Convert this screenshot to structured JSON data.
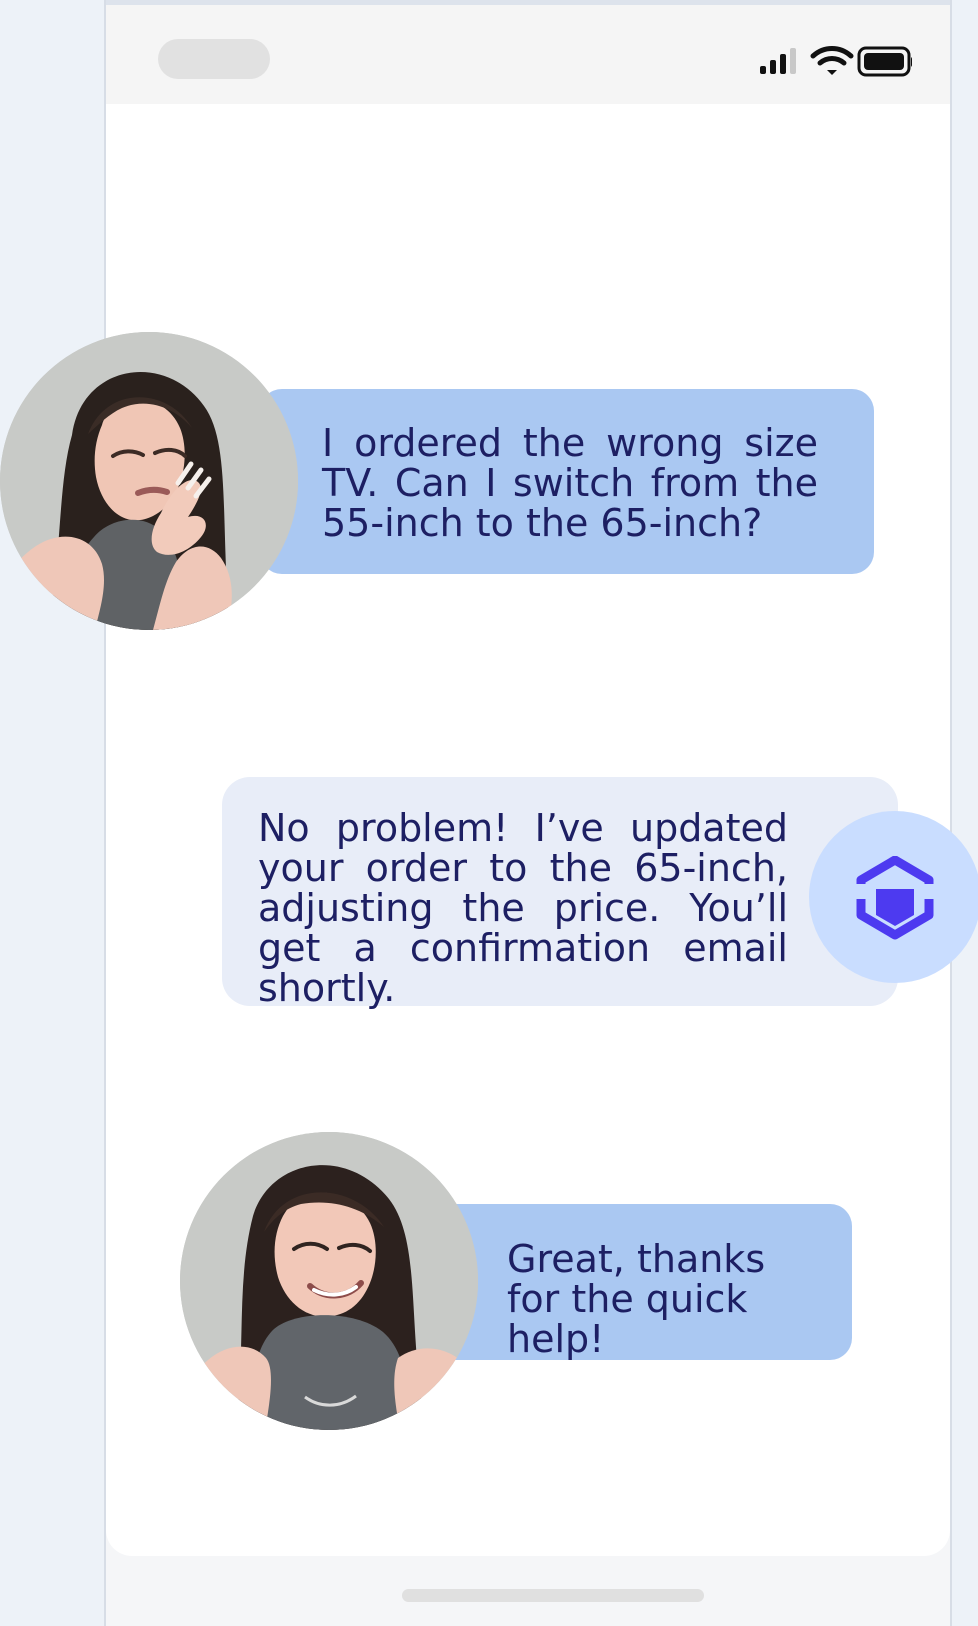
{
  "status": {
    "signal_icon": "cellular-signal-icon",
    "wifi_icon": "wifi-icon",
    "battery_icon": "battery-icon"
  },
  "chat": {
    "messages": [
      {
        "sender": "customer",
        "avatar_icon": "customer-avatar",
        "text": "I ordered the wrong size TV. Can I switch from the 55-inch to the 65-inch?"
      },
      {
        "sender": "agent",
        "avatar_icon": "assistant-logo-icon",
        "text": "No problem! I’ve updated your order to the 65-inch, adjusting the price. You’ll get a confirmation email shortly."
      },
      {
        "sender": "customer",
        "avatar_icon": "customer-avatar",
        "text": "Great, thanks for the quick help!"
      }
    ]
  },
  "colors": {
    "customer_bubble": "#aac8f2",
    "agent_bubble": "#e8edf8",
    "agent_avatar": "#c9ddff",
    "agent_logo": "#4d3af0",
    "text": "#1d1f63"
  }
}
